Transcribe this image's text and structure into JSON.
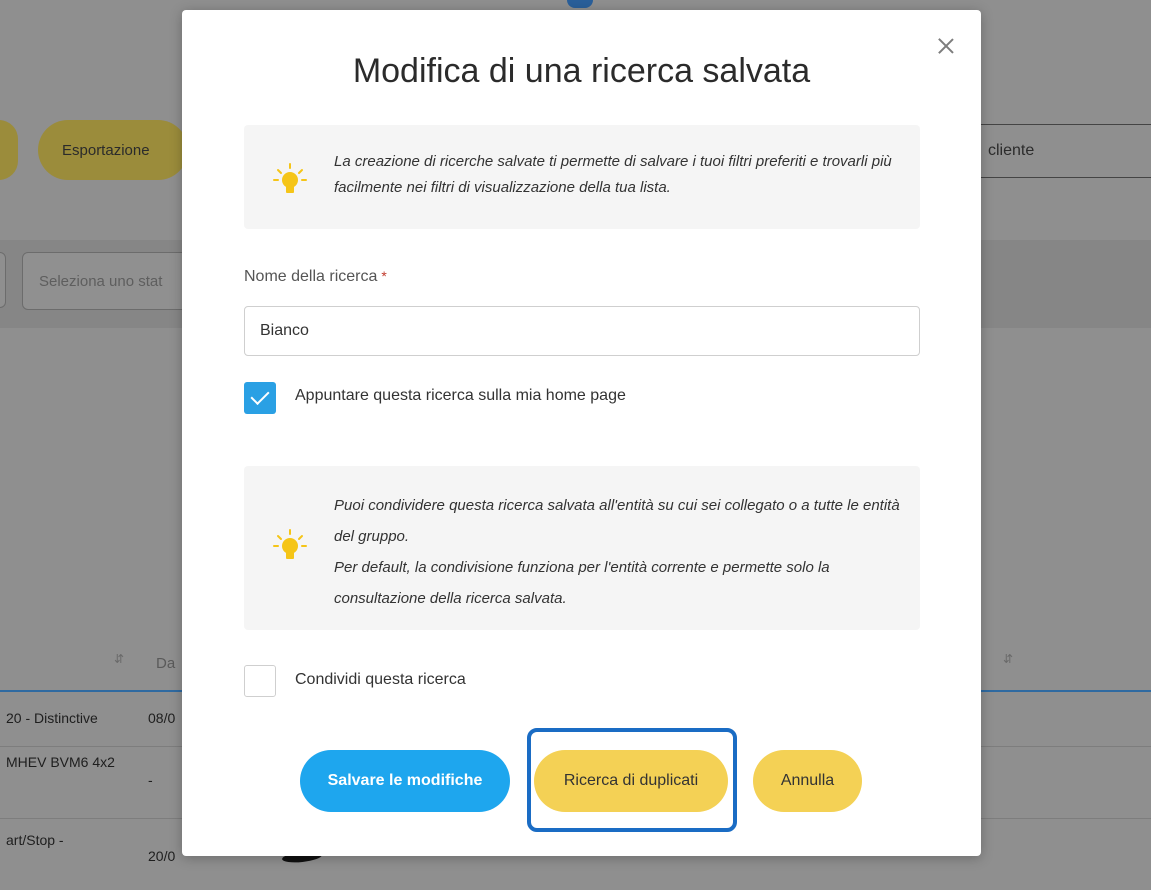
{
  "background": {
    "export_button": "Esportazione",
    "client_label": "cliente",
    "status_select_placeholder": "Seleziona uno stat",
    "column_header_da": "Da",
    "sort_icon": "sort-arrows-icon",
    "rows": [
      {
        "col1": "20 - Distinctive",
        "col2": "08/0"
      },
      {
        "col1": "MHEV BVM6 4x2",
        "col2": "-"
      },
      {
        "col1": "art/Stop -",
        "col2": "20/0"
      }
    ]
  },
  "modal": {
    "title": "Modifica di una ricerca salvata",
    "close_icon": "close-icon",
    "info_top": "La creazione di ricerche salvate ti permette di salvare i tuoi filtri preferiti e trovarli più facilmente nei filtri di visualizzazione della tua lista.",
    "search_name_label": "Nome della ricerca",
    "required_mark": "*",
    "search_name_value": "Bianco",
    "pin_checkbox": {
      "label": "Appuntare questa ricerca sulla mia home page",
      "checked": true
    },
    "info_share": {
      "line1": "Puoi condividere questa ricerca salvata all'entità su cui sei collegato o a tutte le entità del gruppo.",
      "line2": "Per default, la condivisione funziona per l'entità corrente e permette solo la consultazione della ricerca salvata."
    },
    "share_checkbox": {
      "label": "Condividi questa ricerca",
      "checked": false
    },
    "buttons": {
      "save": "Salvare le modifiche",
      "duplicates": "Ricerca di duplicati",
      "cancel": "Annulla"
    },
    "colors": {
      "primary": "#1ea6ee",
      "secondary": "#f4d155",
      "highlight_frame": "#1a6cc4"
    }
  }
}
